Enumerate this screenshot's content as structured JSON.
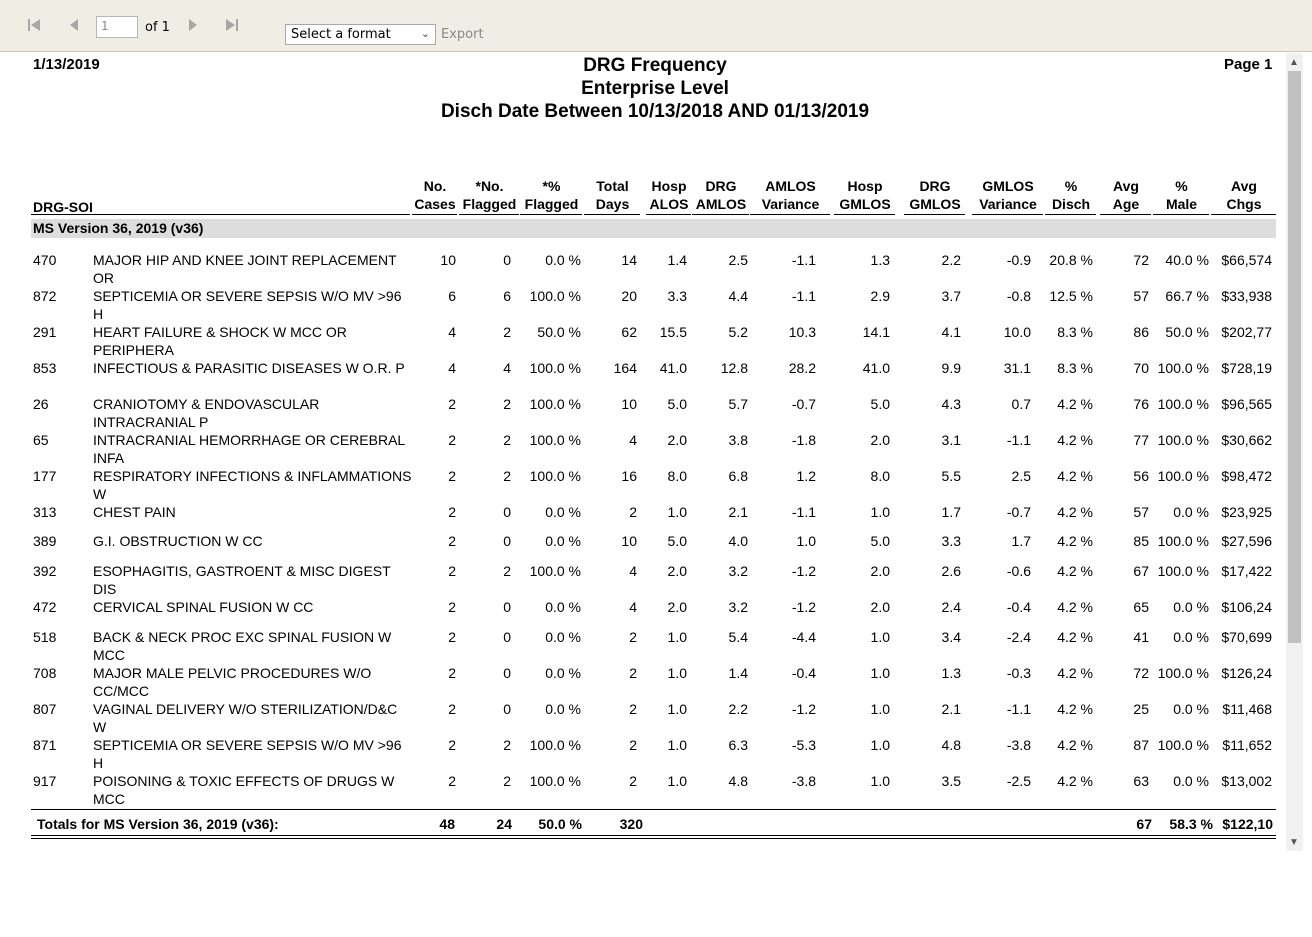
{
  "toolbar": {
    "page_value": "1",
    "of_label": "of 1",
    "format_select": "Select a format",
    "export_label": "Export"
  },
  "report": {
    "date": "1/13/2019",
    "page": "Page 1",
    "title": "DRG Frequency",
    "subtitle": "Enterprise Level",
    "subtitle2": "Disch Date Between 10/13/2018 AND 01/13/2019"
  },
  "headers": {
    "drg_soi": "DRG-SOI",
    "cases": [
      "No.",
      "Cases"
    ],
    "flagged": [
      "*No.",
      "Flagged"
    ],
    "pct_flagged": [
      "*%",
      "Flagged"
    ],
    "total_days": [
      "Total",
      "Days"
    ],
    "hosp_alos": [
      "Hosp",
      "ALOS"
    ],
    "drg_amlos": [
      "DRG",
      "AMLOS"
    ],
    "amlos_var": [
      "AMLOS",
      "Variance"
    ],
    "hosp_gmlos": [
      "Hosp",
      "GMLOS"
    ],
    "drg_gmlos": [
      "DRG",
      "GMLOS"
    ],
    "gmlos_var": [
      "GMLOS",
      "Variance"
    ],
    "pct_disch": [
      "%",
      "Disch"
    ],
    "avg_age": [
      "Avg",
      "Age"
    ],
    "pct_male": [
      "%",
      "Male"
    ],
    "avg_chgs": [
      "Avg",
      "Chgs"
    ]
  },
  "section_label": "MS Version 36, 2019 (v36)",
  "rows": [
    {
      "drg": "470",
      "desc": "MAJOR HIP AND KNEE JOINT REPLACEMENT OR",
      "cases": "10",
      "flagged": "0",
      "pctf": "0.0 %",
      "days": "14",
      "halos": "1.4",
      "amlos": "2.5",
      "avar": "-1.1",
      "hgmlos": "1.3",
      "dgmlos": "2.2",
      "gvar": "-0.9",
      "disch": "20.8 %",
      "age": "72",
      "male": "40.0 %",
      "chgs": "$66,574"
    },
    {
      "drg": "872",
      "desc": "SEPTICEMIA OR SEVERE SEPSIS W/O MV >96 H",
      "cases": "6",
      "flagged": "6",
      "pctf": "100.0 %",
      "days": "20",
      "halos": "3.3",
      "amlos": "4.4",
      "avar": "-1.1",
      "hgmlos": "2.9",
      "dgmlos": "3.7",
      "gvar": "-0.8",
      "disch": "12.5 %",
      "age": "57",
      "male": "66.7 %",
      "chgs": "$33,938"
    },
    {
      "drg": "291",
      "desc": "HEART FAILURE & SHOCK W MCC OR PERIPHERA",
      "cases": "4",
      "flagged": "2",
      "pctf": "50.0 %",
      "days": "62",
      "halos": "15.5",
      "amlos": "5.2",
      "avar": "10.3",
      "hgmlos": "14.1",
      "dgmlos": "4.1",
      "gvar": "10.0",
      "disch": "8.3 %",
      "age": "86",
      "male": "50.0 %",
      "chgs": "$202,77"
    },
    {
      "drg": "853",
      "desc": "INFECTIOUS & PARASITIC DISEASES W O.R. P",
      "cases": "4",
      "flagged": "4",
      "pctf": "100.0 %",
      "days": "164",
      "halos": "41.0",
      "amlos": "12.8",
      "avar": "28.2",
      "hgmlos": "41.0",
      "dgmlos": "9.9",
      "gvar": "31.1",
      "disch": "8.3 %",
      "age": "70",
      "male": "100.0 %",
      "chgs": "$728,19"
    },
    {
      "drg": "26",
      "desc": "CRANIOTOMY & ENDOVASCULAR INTRACRANIAL P",
      "cases": "2",
      "flagged": "2",
      "pctf": "100.0 %",
      "days": "10",
      "halos": "5.0",
      "amlos": "5.7",
      "avar": "-0.7",
      "hgmlos": "5.0",
      "dgmlos": "4.3",
      "gvar": "0.7",
      "disch": "4.2 %",
      "age": "76",
      "male": "100.0 %",
      "chgs": "$96,565"
    },
    {
      "drg": "65",
      "desc": "INTRACRANIAL HEMORRHAGE OR CEREBRAL INFA",
      "cases": "2",
      "flagged": "2",
      "pctf": "100.0 %",
      "days": "4",
      "halos": "2.0",
      "amlos": "3.8",
      "avar": "-1.8",
      "hgmlos": "2.0",
      "dgmlos": "3.1",
      "gvar": "-1.1",
      "disch": "4.2 %",
      "age": "77",
      "male": "100.0 %",
      "chgs": "$30,662"
    },
    {
      "drg": "177",
      "desc": "RESPIRATORY INFECTIONS & INFLAMMATIONS W",
      "cases": "2",
      "flagged": "2",
      "pctf": "100.0 %",
      "days": "16",
      "halos": "8.0",
      "amlos": "6.8",
      "avar": "1.2",
      "hgmlos": "8.0",
      "dgmlos": "5.5",
      "gvar": "2.5",
      "disch": "4.2 %",
      "age": "56",
      "male": "100.0 %",
      "chgs": "$98,472"
    },
    {
      "drg": "313",
      "desc": "CHEST PAIN",
      "cases": "2",
      "flagged": "0",
      "pctf": "0.0 %",
      "days": "2",
      "halos": "1.0",
      "amlos": "2.1",
      "avar": "-1.1",
      "hgmlos": "1.0",
      "dgmlos": "1.7",
      "gvar": "-0.7",
      "disch": "4.2 %",
      "age": "57",
      "male": "0.0 %",
      "chgs": "$23,925"
    },
    {
      "drg": "389",
      "desc": "G.I. OBSTRUCTION W CC",
      "cases": "2",
      "flagged": "0",
      "pctf": "0.0 %",
      "days": "10",
      "halos": "5.0",
      "amlos": "4.0",
      "avar": "1.0",
      "hgmlos": "5.0",
      "dgmlos": "3.3",
      "gvar": "1.7",
      "disch": "4.2 %",
      "age": "85",
      "male": "100.0 %",
      "chgs": "$27,596"
    },
    {
      "drg": "392",
      "desc": "ESOPHAGITIS, GASTROENT & MISC DIGEST DIS",
      "cases": "2",
      "flagged": "2",
      "pctf": "100.0 %",
      "days": "4",
      "halos": "2.0",
      "amlos": "3.2",
      "avar": "-1.2",
      "hgmlos": "2.0",
      "dgmlos": "2.6",
      "gvar": "-0.6",
      "disch": "4.2 %",
      "age": "67",
      "male": "100.0 %",
      "chgs": "$17,422"
    },
    {
      "drg": "472",
      "desc": "CERVICAL SPINAL FUSION W CC",
      "cases": "2",
      "flagged": "0",
      "pctf": "0.0 %",
      "days": "4",
      "halos": "2.0",
      "amlos": "3.2",
      "avar": "-1.2",
      "hgmlos": "2.0",
      "dgmlos": "2.4",
      "gvar": "-0.4",
      "disch": "4.2 %",
      "age": "65",
      "male": "0.0 %",
      "chgs": "$106,24"
    },
    {
      "drg": "518",
      "desc": "BACK & NECK PROC EXC SPINAL FUSION W MCC",
      "cases": "2",
      "flagged": "0",
      "pctf": "0.0 %",
      "days": "2",
      "halos": "1.0",
      "amlos": "5.4",
      "avar": "-4.4",
      "hgmlos": "1.0",
      "dgmlos": "3.4",
      "gvar": "-2.4",
      "disch": "4.2 %",
      "age": "41",
      "male": "0.0 %",
      "chgs": "$70,699"
    },
    {
      "drg": "708",
      "desc": "MAJOR MALE PELVIC PROCEDURES W/O CC/MCC",
      "cases": "2",
      "flagged": "0",
      "pctf": "0.0 %",
      "days": "2",
      "halos": "1.0",
      "amlos": "1.4",
      "avar": "-0.4",
      "hgmlos": "1.0",
      "dgmlos": "1.3",
      "gvar": "-0.3",
      "disch": "4.2 %",
      "age": "72",
      "male": "100.0 %",
      "chgs": "$126,24"
    },
    {
      "drg": "807",
      "desc": "VAGINAL DELIVERY W/O STERILIZATION/D&C W",
      "cases": "2",
      "flagged": "0",
      "pctf": "0.0 %",
      "days": "2",
      "halos": "1.0",
      "amlos": "2.2",
      "avar": "-1.2",
      "hgmlos": "1.0",
      "dgmlos": "2.1",
      "gvar": "-1.1",
      "disch": "4.2 %",
      "age": "25",
      "male": "0.0 %",
      "chgs": "$11,468"
    },
    {
      "drg": "871",
      "desc": "SEPTICEMIA OR SEVERE SEPSIS W/O MV >96 H",
      "cases": "2",
      "flagged": "2",
      "pctf": "100.0 %",
      "days": "2",
      "halos": "1.0",
      "amlos": "6.3",
      "avar": "-5.3",
      "hgmlos": "1.0",
      "dgmlos": "4.8",
      "gvar": "-3.8",
      "disch": "4.2 %",
      "age": "87",
      "male": "100.0 %",
      "chgs": "$11,652"
    },
    {
      "drg": "917",
      "desc": "POISONING & TOXIC EFFECTS OF DRUGS W MCC",
      "cases": "2",
      "flagged": "2",
      "pctf": "100.0 %",
      "days": "2",
      "halos": "1.0",
      "amlos": "4.8",
      "avar": "-3.8",
      "hgmlos": "1.0",
      "dgmlos": "3.5",
      "gvar": "-2.5",
      "disch": "4.2 %",
      "age": "63",
      "male": "0.0 %",
      "chgs": "$13,002"
    }
  ],
  "totals": {
    "label": "Totals for MS Version 36, 2019 (v36):",
    "cases": "48",
    "flagged": "24",
    "pctf": "50.0 %",
    "days": "320",
    "age": "67",
    "male": "58.3 %",
    "chgs": "$122,10"
  }
}
